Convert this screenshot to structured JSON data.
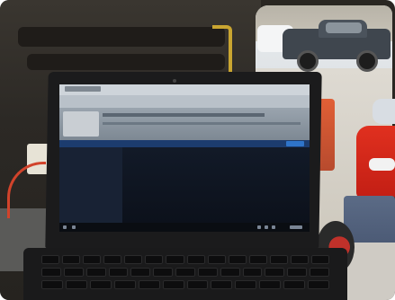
{
  "scene": {
    "colors": {
      "van_interior": "#2c2925",
      "laptop_body": "#1b1b1c",
      "screen_blue_bar": "#1c3c6e",
      "accent_button": "#2f74c9",
      "hi_vis_red": "#d6271a",
      "truck": "#3f464e"
    },
    "screen": {
      "header_bar": "",
      "status": ""
    }
  }
}
